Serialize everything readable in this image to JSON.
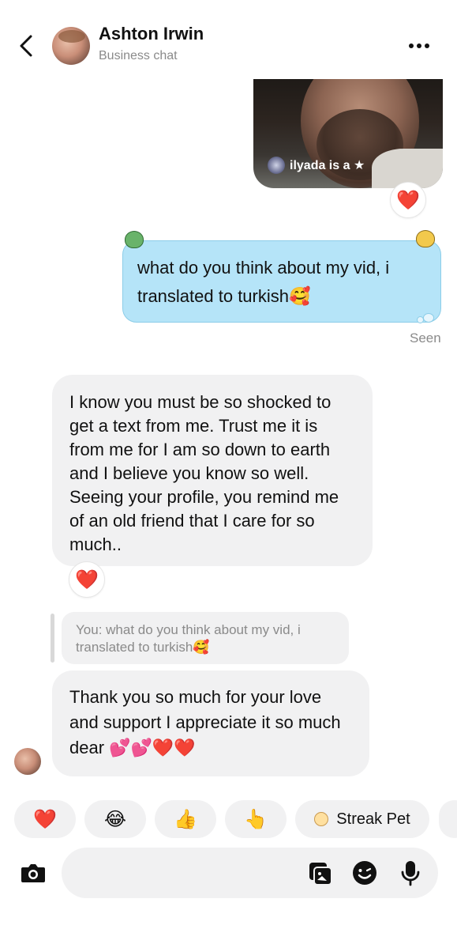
{
  "header": {
    "name": "Ashton Irwin",
    "subtitle": "Business chat"
  },
  "media": {
    "tag": "ilyada is a ★"
  },
  "reactions": {
    "media": "❤️",
    "message": "❤️"
  },
  "sent": {
    "text": "what do you think about my vid, i translated to turkish🥰",
    "status": "Seen"
  },
  "received": [
    {
      "text": "I know you must be so shocked to get a text from me. Trust me it is from me for I am so down to earth and I believe you know so well. Seeing your profile, you remind me of an old friend that I care for so much.."
    },
    {
      "quote": "You: what do you think about my vid, i translated to turkish🥰",
      "text": "Thank you so much for your love and support I appreciate it so much dear 💕💕❤️❤️"
    }
  ],
  "quick_replies": {
    "heart": "❤️",
    "laugh": "😂",
    "thumbs_up": "👍",
    "point": "👆",
    "streak_pet": "Streak Pet"
  },
  "icons": {
    "back": "chevron-left-icon",
    "more": "more-dots-icon",
    "camera": "camera-icon",
    "sticker": "sticker-icon",
    "emoji": "emoji-icon",
    "mic": "microphone-icon"
  },
  "colors": {
    "sent_bubble": "#b5e4f8",
    "received_bubble": "#f1f1f2",
    "muted_text": "#8a8a8a"
  }
}
